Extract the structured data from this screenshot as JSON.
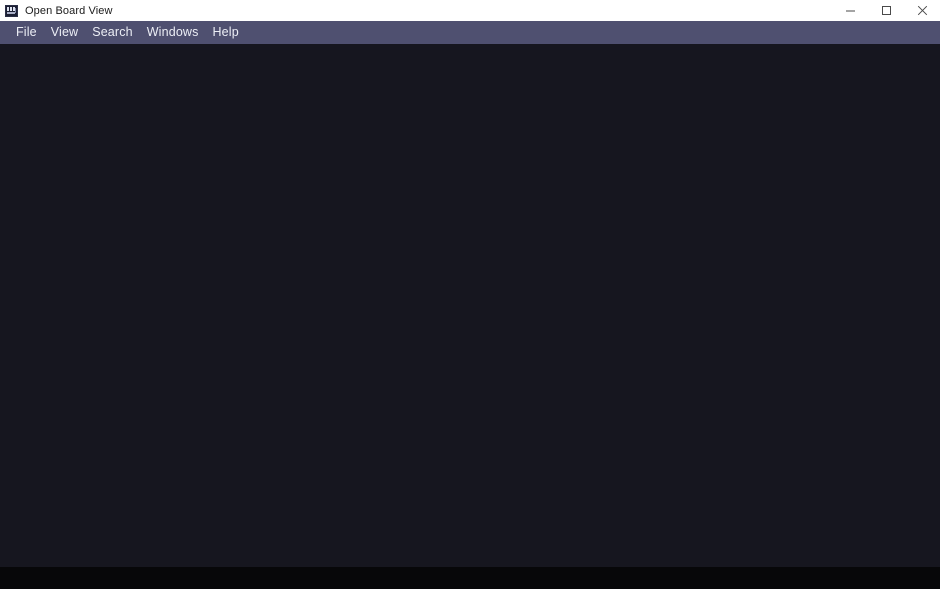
{
  "window": {
    "title": "Open Board View",
    "app_icon": "board-chip-icon",
    "controls": {
      "minimize": "minimize-icon",
      "maximize": "maximize-icon",
      "close": "close-icon"
    }
  },
  "menubar": {
    "items": [
      {
        "label": "File"
      },
      {
        "label": "View"
      },
      {
        "label": "Search"
      },
      {
        "label": "Windows"
      },
      {
        "label": "Help"
      }
    ]
  },
  "canvas": {
    "content": ""
  },
  "statusbar": {
    "text": ""
  },
  "colors": {
    "titlebar_bg": "#ffffff",
    "titlebar_text": "#1a1a1a",
    "menubar_bg": "#4f5070",
    "menubar_text": "#eceef5",
    "canvas_bg": "#16161f",
    "statusbar_bg": "#070709"
  }
}
